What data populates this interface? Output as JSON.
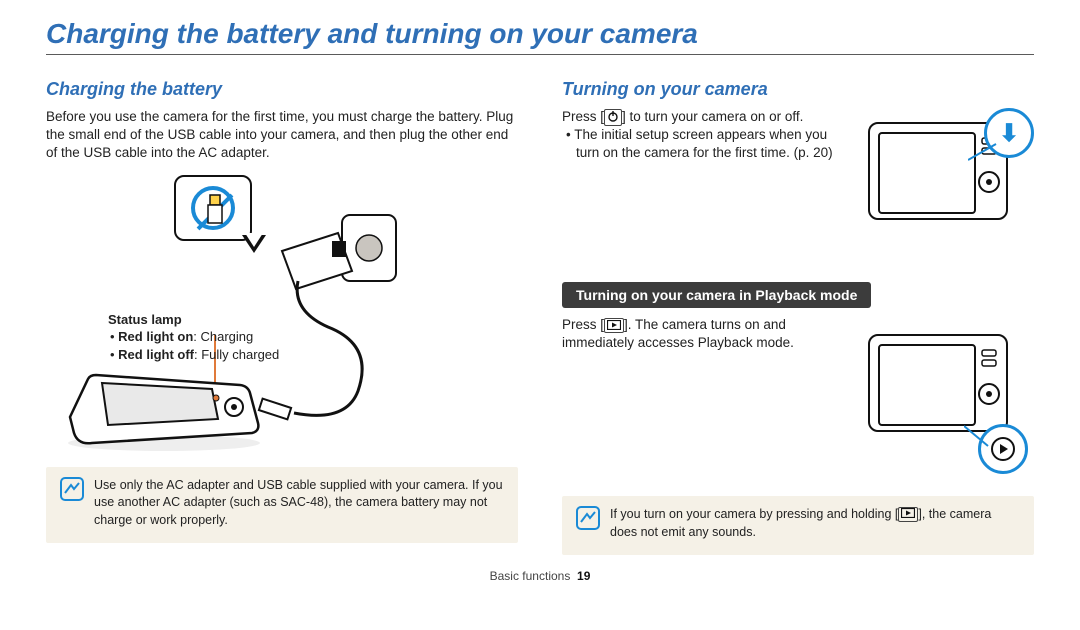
{
  "page_title": "Charging the battery and turning on your camera",
  "footer": {
    "section": "Basic functions",
    "page": "19"
  },
  "left": {
    "heading": "Charging the battery",
    "intro": "Before you use the camera for the first time, you must charge the battery. Plug the small end of the USB cable into your camera, and then plug the other end of the USB cable into the AC adapter.",
    "status": {
      "header": "Status lamp",
      "on_label": "Red light on",
      "on_desc": ": Charging",
      "off_label": "Red light off",
      "off_desc": ": Fully charged"
    },
    "tip": "Use only the AC adapter and USB cable supplied with your camera. If you use another AC adapter (such as SAC-48), the camera battery may not charge or work properly."
  },
  "right": {
    "heading": "Turning on your camera",
    "press_prefix": "Press [",
    "press_suffix": "] to turn your camera on or off.",
    "bullet": "The initial setup screen appears when you turn on the camera for the first time. (p. 20)",
    "playback_heading": "Turning on your camera in Playback mode",
    "playback_press_prefix": "Press [",
    "playback_press_suffix": "]. The camera turns on and immediately accesses Playback mode.",
    "tip_prefix": "If you turn on your camera by pressing and holding [",
    "tip_suffix": "], the camera does not emit any sounds."
  },
  "icons": {
    "power": "⏻",
    "playback": "▶",
    "arrow_down": "⬇"
  }
}
